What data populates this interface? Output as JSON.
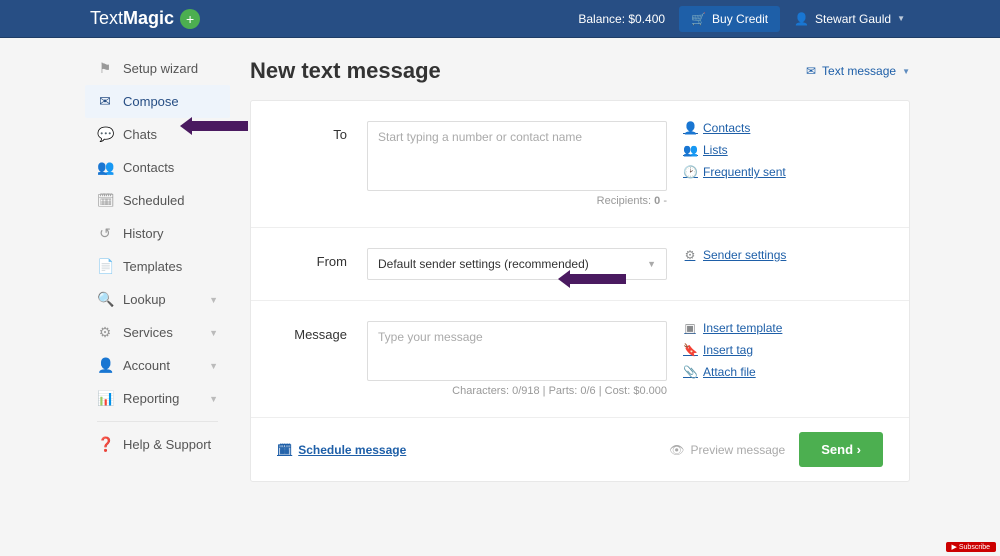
{
  "header": {
    "logo_text": "Text",
    "logo_bold": "Magic",
    "balance_label": "Balance: $0.400",
    "buy_credit_label": "Buy Credit",
    "user_name": "Stewart Gauld"
  },
  "sidebar": {
    "items": [
      {
        "label": "Setup wizard",
        "icon": "⚑",
        "chev": false
      },
      {
        "label": "Compose",
        "icon": "✉",
        "chev": false
      },
      {
        "label": "Chats",
        "icon": "💬",
        "chev": false
      },
      {
        "label": "Contacts",
        "icon": "👥",
        "chev": false
      },
      {
        "label": "Scheduled",
        "icon": "🗓",
        "chev": false
      },
      {
        "label": "History",
        "icon": "↺",
        "chev": false
      },
      {
        "label": "Templates",
        "icon": "📄",
        "chev": false
      },
      {
        "label": "Lookup",
        "icon": "🔍",
        "chev": true
      },
      {
        "label": "Services",
        "icon": "⚙",
        "chev": true
      },
      {
        "label": "Account",
        "icon": "👤",
        "chev": true
      },
      {
        "label": "Reporting",
        "icon": "📊",
        "chev": true
      }
    ],
    "help_label": "Help & Support"
  },
  "main": {
    "title": "New text message",
    "type_dropdown": "Text message",
    "to": {
      "label": "To",
      "placeholder": "Start typing a number or contact name",
      "recipients_prefix": "Recipients: ",
      "recipients_count": "0",
      "recipients_suffix": " -",
      "links": {
        "contacts": "Contacts",
        "lists": "Lists",
        "frequent": "Frequently sent"
      }
    },
    "from": {
      "label": "From",
      "value": "Default sender settings (recommended)",
      "settings_link": "Sender settings"
    },
    "message": {
      "label": "Message",
      "placeholder": "Type your message",
      "stats": "Characters: 0/918  |  Parts: 0/6  |  Cost: $0.000",
      "links": {
        "template": "Insert template",
        "tag": "Insert tag",
        "attach": "Attach file"
      }
    },
    "footer": {
      "schedule": "Schedule message",
      "preview": "Preview message",
      "send": "Send"
    }
  }
}
